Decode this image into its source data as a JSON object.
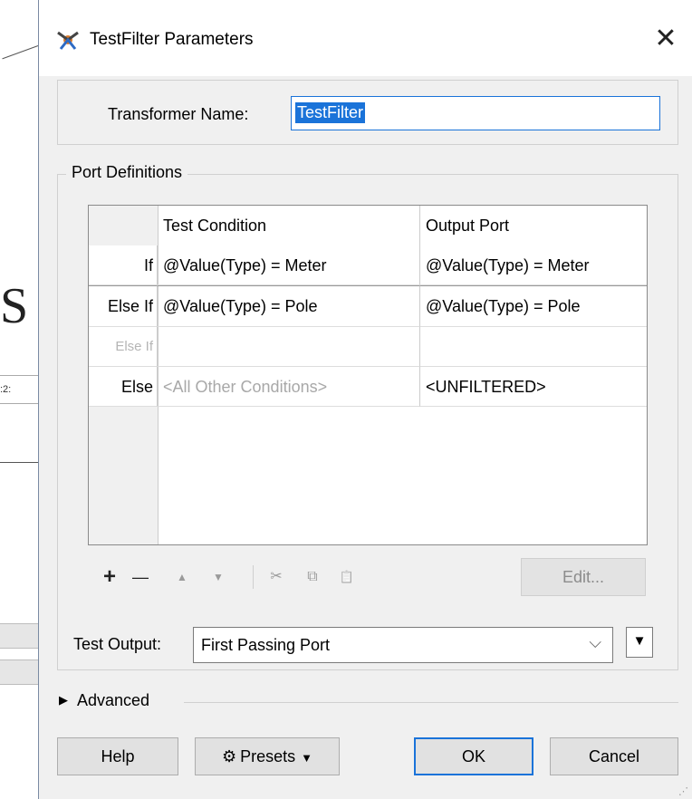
{
  "background": {
    "glyph": "S",
    "node_text": ":2:"
  },
  "dialog": {
    "title": "TestFilter Parameters",
    "close_glyph": "✕",
    "transformer_name_label": "Transformer Name:",
    "transformer_name_value": "TestFilter",
    "port_definitions_label": "Port Definitions",
    "columns": [
      "Test Condition",
      "Output Port"
    ],
    "rows": [
      {
        "keyword": "If",
        "condition": "@Value(Type) = Meter",
        "output": "@Value(Type) = Meter"
      },
      {
        "keyword": "Else If",
        "condition": "@Value(Type) = Pole",
        "output": "@Value(Type) = Pole"
      },
      {
        "keyword": "Else If",
        "condition": "",
        "output": ""
      },
      {
        "keyword": "Else",
        "condition": "<All Other Conditions>",
        "output": "<UNFILTERED>"
      }
    ],
    "toolbar": {
      "add": "+",
      "remove": "—",
      "up": "▲",
      "down": "▼",
      "cut": "✂",
      "copy": "⧉",
      "paste": "📋"
    },
    "edit_button": "Edit...",
    "test_output_label": "Test Output:",
    "test_output_value": "First Passing Port",
    "advanced_label": "Advanced",
    "buttons": {
      "help": "Help",
      "presets": "Presets",
      "ok": "OK",
      "cancel": "Cancel"
    },
    "colors": {
      "accent": "#1a73d9",
      "dialog_bg": "#f0f0f0"
    }
  }
}
